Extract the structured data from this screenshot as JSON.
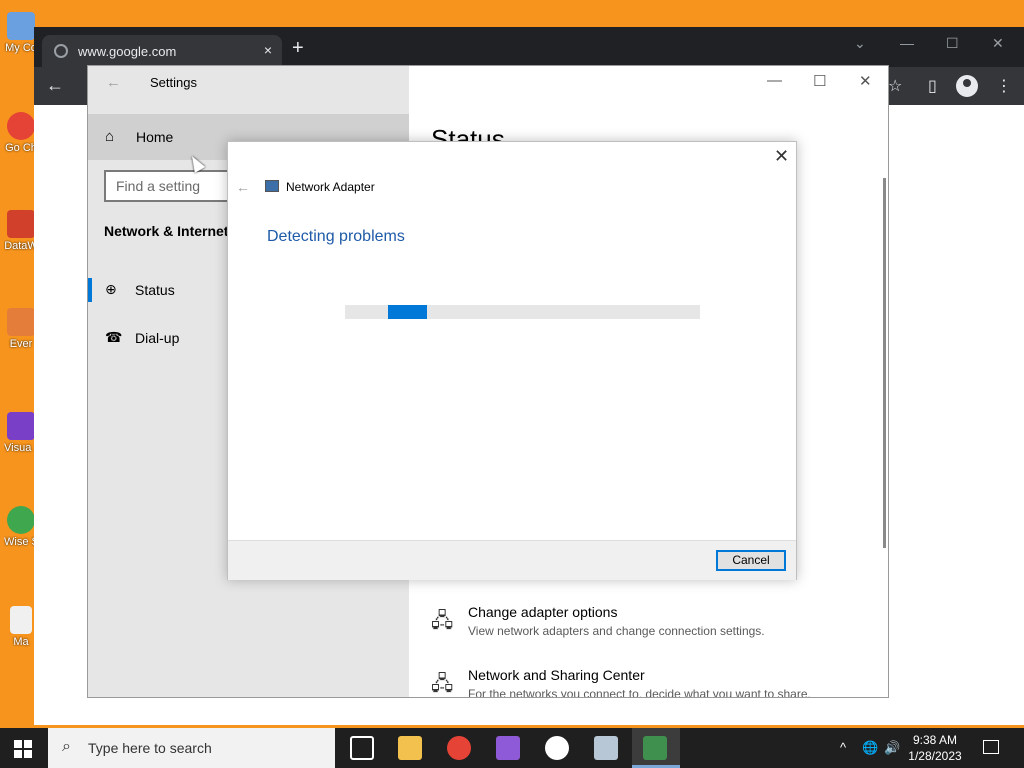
{
  "desktop": {
    "icons": [
      {
        "label": "My Co",
        "icon": "computer-icon",
        "color": "#6aa0e0"
      },
      {
        "label": "Go Ch",
        "icon": "chrome-icon",
        "color": "#e54335"
      },
      {
        "label": "DataW",
        "icon": "datawrapper-icon",
        "color": "#d0402a"
      },
      {
        "label": "Ever",
        "icon": "everything-icon",
        "color": "#e57d3a"
      },
      {
        "label": "Visua 2",
        "icon": "visual-studio-icon",
        "color": "#7a3fc7"
      },
      {
        "label": "Wise Shut",
        "icon": "wise-shutdown-icon",
        "color": "#3fa84e"
      },
      {
        "label": "Ma",
        "icon": "document-icon",
        "color": "#f0f0f0"
      }
    ]
  },
  "chrome": {
    "tab_title": "www.google.com",
    "tab_close": "×",
    "new_tab": "+",
    "controls": {
      "dropdown": "⌄",
      "minimize": "—",
      "maximize": "☐",
      "close": "✕"
    },
    "back": "←",
    "star": "☆",
    "side_panel": "▯",
    "menu": "⋮"
  },
  "settings": {
    "window_title": "Settings",
    "back": "←",
    "controls": {
      "minimize": "—",
      "maximize": "☐",
      "close": "✕"
    },
    "home_label": "Home",
    "home_icon": "⌂",
    "search_placeholder": "Find a setting",
    "section_title": "Network & Internet",
    "nav_items": [
      {
        "label": "Status",
        "icon": "⊕",
        "active": true
      },
      {
        "label": "Dial-up",
        "icon": "☎",
        "active": false
      }
    ],
    "page_title": "Status",
    "links": [
      {
        "title": "Change adapter options",
        "desc": "View network adapters and change connection settings.",
        "icon": "🖧"
      },
      {
        "title": "Network and Sharing Center",
        "desc": "For the networks you connect to, decide what you want to share.",
        "icon": "🖧"
      }
    ]
  },
  "dialog": {
    "close": "✕",
    "back": "←",
    "app_title": "Network Adapter",
    "heading": "Detecting problems",
    "progress_fraction": 0.11,
    "progress_offset_fraction": 0.12,
    "cancel_label": "Cancel",
    "accent": "#0078d7"
  },
  "taskbar": {
    "search_placeholder": "Type here to search",
    "search_icon": "⌕",
    "apps": [
      {
        "name": "task-view-icon",
        "color": "#ffffff"
      },
      {
        "name": "file-explorer-icon",
        "color": "#f2c14e"
      },
      {
        "name": "chrome-icon",
        "color": "#e54335"
      },
      {
        "name": "visual-studio-icon",
        "color": "#8f5ad8"
      },
      {
        "name": "settings-gear-icon",
        "color": "#ffffff"
      },
      {
        "name": "network-diagnostics-icon",
        "color": "#b8c7d6"
      },
      {
        "name": "troubleshooter-icon",
        "color": "#3f8f4e"
      }
    ],
    "tray": {
      "chevron": "^",
      "network": "🌐",
      "volume": "🔊"
    },
    "time": "9:38 AM",
    "date": "1/28/2023"
  }
}
